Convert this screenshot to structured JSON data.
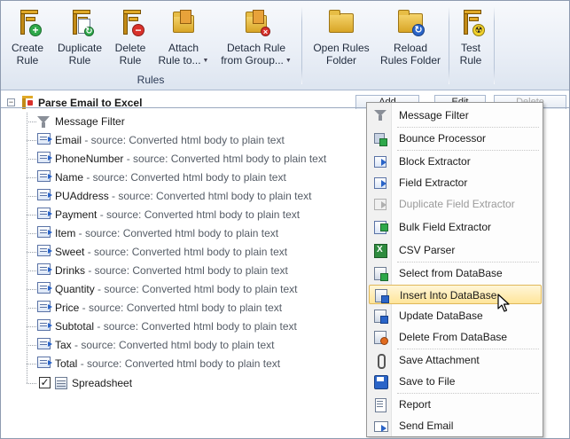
{
  "ribbon": {
    "buttons": [
      {
        "label": "Create\nRule",
        "icon": "create-rule-icon"
      },
      {
        "label": "Duplicate\nRule",
        "icon": "duplicate-rule-icon"
      },
      {
        "label": "Delete\nRule",
        "icon": "delete-rule-icon"
      },
      {
        "label": "Attach\nRule to...",
        "icon": "attach-rule-icon",
        "dropdown": true
      },
      {
        "label": "Detach Rule\nfrom Group...",
        "icon": "detach-rule-icon",
        "dropdown": true
      },
      {
        "label": "Open Rules\nFolder",
        "icon": "folder-icon"
      },
      {
        "label": "Reload\nRules Folder",
        "icon": "reload-folder-icon"
      },
      {
        "label": "Test\nRule",
        "icon": "test-rule-icon"
      }
    ],
    "group_label": "Rules"
  },
  "tree": {
    "root": {
      "label": "Parse Email to Excel",
      "expander": "⊟"
    },
    "header_buttons": {
      "add": "Add",
      "edit": "Edit",
      "delete": "Delete"
    },
    "filter": {
      "label": "Message Filter"
    },
    "fields": [
      {
        "name": "Email",
        "source": " - source: Converted html body to plain text"
      },
      {
        "name": "PhoneNumber",
        "source": " - source: Converted html body to plain text"
      },
      {
        "name": "Name",
        "source": " - source: Converted html body to plain text"
      },
      {
        "name": "PUAddress",
        "source": " - source: Converted html body to plain text"
      },
      {
        "name": "Payment",
        "source": " - source: Converted html body to plain text"
      },
      {
        "name": "Item",
        "source": " - source: Converted html body to plain text"
      },
      {
        "name": "Sweet",
        "source": " - source: Converted html body to plain text"
      },
      {
        "name": "Drinks",
        "source": " - source: Converted html body to plain text"
      },
      {
        "name": "Quantity",
        "source": " - source: Converted html body to plain text"
      },
      {
        "name": "Price",
        "source": " - source: Converted html body to plain text"
      },
      {
        "name": "Subtotal",
        "source": " - source: Converted html body to plain text"
      },
      {
        "name": "Tax",
        "source": " - source: Converted html body to plain text"
      },
      {
        "name": "Total",
        "source": " - source: Converted html body to plain text"
      }
    ],
    "spreadsheet": {
      "label": "Spreadsheet",
      "checked": true,
      "check_glyph": "✓"
    }
  },
  "context_menu": {
    "items": [
      {
        "label": "Message Filter",
        "icon": "funnel-icon"
      },
      {
        "label": "Bounce Processor",
        "icon": "bounce-processor-icon"
      },
      {
        "label": "Block Extractor",
        "icon": "block-extractor-icon"
      },
      {
        "label": "Field Extractor",
        "icon": "field-extractor-icon"
      },
      {
        "label": "Duplicate Field Extractor",
        "icon": "duplicate-field-extractor-icon",
        "disabled": true
      },
      {
        "label": "Bulk Field Extractor",
        "icon": "bulk-field-extractor-icon"
      },
      {
        "label": "CSV Parser",
        "icon": "csv-parser-icon"
      },
      {
        "label": "Select from DataBase",
        "icon": "select-database-icon"
      },
      {
        "label": "Insert Into DataBase",
        "icon": "insert-database-icon",
        "highlighted": true
      },
      {
        "label": "Update DataBase",
        "icon": "update-database-icon"
      },
      {
        "label": "Delete From DataBase",
        "icon": "delete-database-icon"
      },
      {
        "label": "Save Attachment",
        "icon": "paperclip-icon"
      },
      {
        "label": "Save to File",
        "icon": "save-file-icon"
      },
      {
        "label": "Report",
        "icon": "report-icon"
      },
      {
        "label": "Send Email",
        "icon": "send-email-icon"
      }
    ]
  }
}
